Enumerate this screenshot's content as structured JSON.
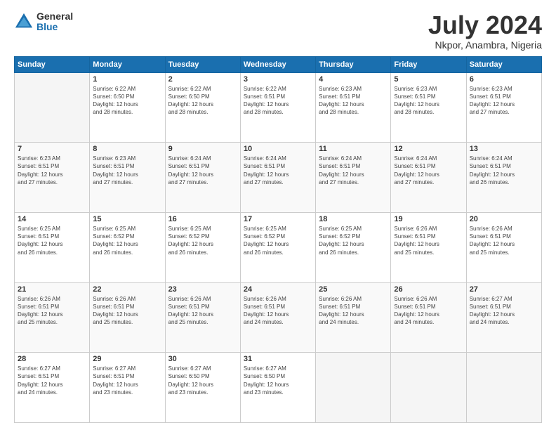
{
  "logo": {
    "general": "General",
    "blue": "Blue"
  },
  "title": {
    "month_year": "July 2024",
    "location": "Nkpor, Anambra, Nigeria"
  },
  "days_of_week": [
    "Sunday",
    "Monday",
    "Tuesday",
    "Wednesday",
    "Thursday",
    "Friday",
    "Saturday"
  ],
  "weeks": [
    [
      {
        "day": "",
        "info": ""
      },
      {
        "day": "1",
        "info": "Sunrise: 6:22 AM\nSunset: 6:50 PM\nDaylight: 12 hours\nand 28 minutes."
      },
      {
        "day": "2",
        "info": "Sunrise: 6:22 AM\nSunset: 6:50 PM\nDaylight: 12 hours\nand 28 minutes."
      },
      {
        "day": "3",
        "info": "Sunrise: 6:22 AM\nSunset: 6:51 PM\nDaylight: 12 hours\nand 28 minutes."
      },
      {
        "day": "4",
        "info": "Sunrise: 6:23 AM\nSunset: 6:51 PM\nDaylight: 12 hours\nand 28 minutes."
      },
      {
        "day": "5",
        "info": "Sunrise: 6:23 AM\nSunset: 6:51 PM\nDaylight: 12 hours\nand 28 minutes."
      },
      {
        "day": "6",
        "info": "Sunrise: 6:23 AM\nSunset: 6:51 PM\nDaylight: 12 hours\nand 27 minutes."
      }
    ],
    [
      {
        "day": "7",
        "info": "Sunrise: 6:23 AM\nSunset: 6:51 PM\nDaylight: 12 hours\nand 27 minutes."
      },
      {
        "day": "8",
        "info": "Sunrise: 6:23 AM\nSunset: 6:51 PM\nDaylight: 12 hours\nand 27 minutes."
      },
      {
        "day": "9",
        "info": "Sunrise: 6:24 AM\nSunset: 6:51 PM\nDaylight: 12 hours\nand 27 minutes."
      },
      {
        "day": "10",
        "info": "Sunrise: 6:24 AM\nSunset: 6:51 PM\nDaylight: 12 hours\nand 27 minutes."
      },
      {
        "day": "11",
        "info": "Sunrise: 6:24 AM\nSunset: 6:51 PM\nDaylight: 12 hours\nand 27 minutes."
      },
      {
        "day": "12",
        "info": "Sunrise: 6:24 AM\nSunset: 6:51 PM\nDaylight: 12 hours\nand 27 minutes."
      },
      {
        "day": "13",
        "info": "Sunrise: 6:24 AM\nSunset: 6:51 PM\nDaylight: 12 hours\nand 26 minutes."
      }
    ],
    [
      {
        "day": "14",
        "info": "Sunrise: 6:25 AM\nSunset: 6:51 PM\nDaylight: 12 hours\nand 26 minutes."
      },
      {
        "day": "15",
        "info": "Sunrise: 6:25 AM\nSunset: 6:52 PM\nDaylight: 12 hours\nand 26 minutes."
      },
      {
        "day": "16",
        "info": "Sunrise: 6:25 AM\nSunset: 6:52 PM\nDaylight: 12 hours\nand 26 minutes."
      },
      {
        "day": "17",
        "info": "Sunrise: 6:25 AM\nSunset: 6:52 PM\nDaylight: 12 hours\nand 26 minutes."
      },
      {
        "day": "18",
        "info": "Sunrise: 6:25 AM\nSunset: 6:52 PM\nDaylight: 12 hours\nand 26 minutes."
      },
      {
        "day": "19",
        "info": "Sunrise: 6:26 AM\nSunset: 6:51 PM\nDaylight: 12 hours\nand 25 minutes."
      },
      {
        "day": "20",
        "info": "Sunrise: 6:26 AM\nSunset: 6:51 PM\nDaylight: 12 hours\nand 25 minutes."
      }
    ],
    [
      {
        "day": "21",
        "info": "Sunrise: 6:26 AM\nSunset: 6:51 PM\nDaylight: 12 hours\nand 25 minutes."
      },
      {
        "day": "22",
        "info": "Sunrise: 6:26 AM\nSunset: 6:51 PM\nDaylight: 12 hours\nand 25 minutes."
      },
      {
        "day": "23",
        "info": "Sunrise: 6:26 AM\nSunset: 6:51 PM\nDaylight: 12 hours\nand 25 minutes."
      },
      {
        "day": "24",
        "info": "Sunrise: 6:26 AM\nSunset: 6:51 PM\nDaylight: 12 hours\nand 24 minutes."
      },
      {
        "day": "25",
        "info": "Sunrise: 6:26 AM\nSunset: 6:51 PM\nDaylight: 12 hours\nand 24 minutes."
      },
      {
        "day": "26",
        "info": "Sunrise: 6:26 AM\nSunset: 6:51 PM\nDaylight: 12 hours\nand 24 minutes."
      },
      {
        "day": "27",
        "info": "Sunrise: 6:27 AM\nSunset: 6:51 PM\nDaylight: 12 hours\nand 24 minutes."
      }
    ],
    [
      {
        "day": "28",
        "info": "Sunrise: 6:27 AM\nSunset: 6:51 PM\nDaylight: 12 hours\nand 24 minutes."
      },
      {
        "day": "29",
        "info": "Sunrise: 6:27 AM\nSunset: 6:51 PM\nDaylight: 12 hours\nand 23 minutes."
      },
      {
        "day": "30",
        "info": "Sunrise: 6:27 AM\nSunset: 6:50 PM\nDaylight: 12 hours\nand 23 minutes."
      },
      {
        "day": "31",
        "info": "Sunrise: 6:27 AM\nSunset: 6:50 PM\nDaylight: 12 hours\nand 23 minutes."
      },
      {
        "day": "",
        "info": ""
      },
      {
        "day": "",
        "info": ""
      },
      {
        "day": "",
        "info": ""
      }
    ]
  ]
}
